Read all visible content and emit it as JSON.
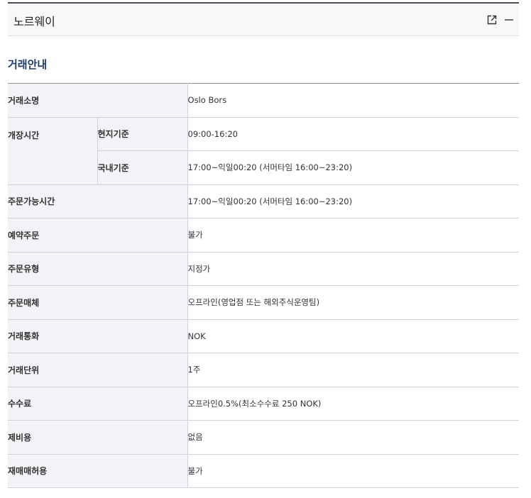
{
  "header": {
    "title": "노르웨이",
    "icons": [
      "external-link-icon",
      "minimize-icon"
    ]
  },
  "section": {
    "title": "거래안내"
  },
  "rows": {
    "exchange_name": {
      "label": "거래소명",
      "value": "Oslo Bors"
    },
    "trading_hours": {
      "label": "개장시간",
      "local": {
        "label": "현지기준",
        "value": "09:00-16:20"
      },
      "domestic": {
        "label": "국내기준",
        "value": "17:00~익일00:20 (서머타임 16:00~23:20)"
      }
    },
    "order_hours": {
      "label": "주문가능시간",
      "value": "17:00~익일00:20 (서머타임 16:00~23:20)"
    },
    "reserve_order": {
      "label": "예약주문",
      "value": "불가"
    },
    "order_type": {
      "label": "주문유형",
      "value": "지정가"
    },
    "order_channel": {
      "label": "주문매체",
      "value": "오프라인(영업점 또는 해외주식운영팀)"
    },
    "currency": {
      "label": "거래통화",
      "value": "NOK"
    },
    "unit": {
      "label": "거래단위",
      "value": "1주"
    },
    "fee": {
      "label": "수수료",
      "value": "오프라인0.5%(최소수수료 250 NOK)"
    },
    "other_costs": {
      "label": "제비용",
      "value": "없음"
    },
    "resale": {
      "label": "재매매허용",
      "value": "불가"
    }
  }
}
